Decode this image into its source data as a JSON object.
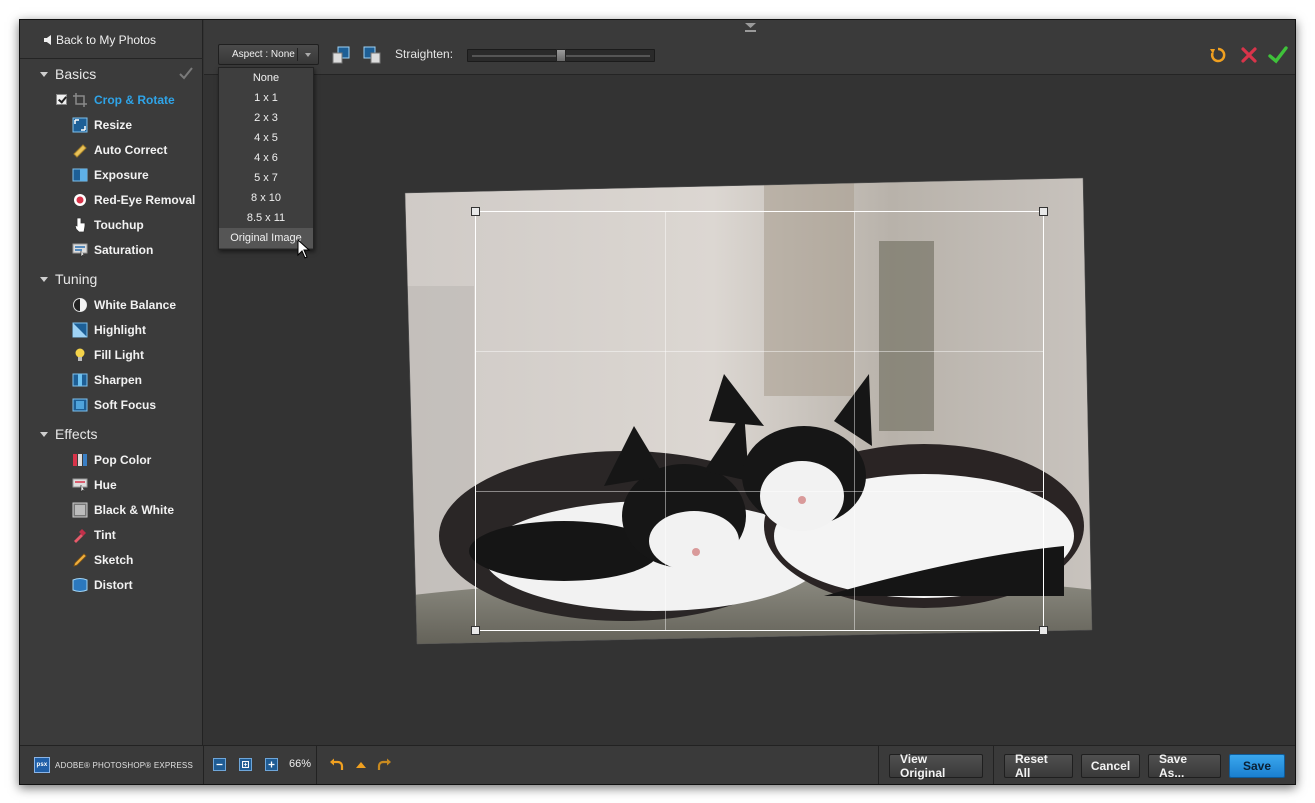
{
  "sidebar": {
    "back_label": "Back to My Photos",
    "sections": [
      {
        "title": "Basics",
        "items": [
          {
            "label": "Crop & Rotate",
            "icon": "crop-icon",
            "active": true,
            "checked": true
          },
          {
            "label": "Resize",
            "icon": "resize-icon"
          },
          {
            "label": "Auto Correct",
            "icon": "auto-correct-icon"
          },
          {
            "label": "Exposure",
            "icon": "exposure-icon"
          },
          {
            "label": "Red-Eye Removal",
            "icon": "red-eye-icon"
          },
          {
            "label": "Touchup",
            "icon": "touchup-icon"
          },
          {
            "label": "Saturation",
            "icon": "saturation-icon"
          }
        ]
      },
      {
        "title": "Tuning",
        "items": [
          {
            "label": "White Balance",
            "icon": "white-balance-icon"
          },
          {
            "label": "Highlight",
            "icon": "highlight-icon"
          },
          {
            "label": "Fill Light",
            "icon": "fill-light-icon"
          },
          {
            "label": "Sharpen",
            "icon": "sharpen-icon"
          },
          {
            "label": "Soft Focus",
            "icon": "soft-focus-icon"
          }
        ]
      },
      {
        "title": "Effects",
        "items": [
          {
            "label": "Pop Color",
            "icon": "pop-color-icon"
          },
          {
            "label": "Hue",
            "icon": "hue-icon"
          },
          {
            "label": "Black & White",
            "icon": "black-white-icon"
          },
          {
            "label": "Tint",
            "icon": "tint-icon"
          },
          {
            "label": "Sketch",
            "icon": "sketch-icon"
          },
          {
            "label": "Distort",
            "icon": "distort-icon"
          }
        ]
      }
    ]
  },
  "toolbar": {
    "aspect_label": "Aspect : None",
    "straighten_label": "Straighten:",
    "straighten_value": 0.5
  },
  "aspect_menu": {
    "items": [
      "None",
      "1 x 1",
      "2 x 3",
      "4 x 5",
      "4 x 6",
      "5 x 7",
      "8 x 10",
      "8.5 x 11",
      "Original Image"
    ],
    "hovered": "Original Image"
  },
  "bottom": {
    "brand": "ADOBE® PHOTOSHOP® EXPRESS",
    "brand_logo": "psx",
    "zoom": "66%",
    "view_original": "View Original",
    "reset_all": "Reset All",
    "cancel": "Cancel",
    "save_as": "Save As...",
    "save": "Save"
  },
  "colors": {
    "accent": "#2fa4e8",
    "panel": "#3b3b3b",
    "canvas": "#333333",
    "cancel_red": "#d8344a",
    "apply_green": "#3fc23a"
  }
}
